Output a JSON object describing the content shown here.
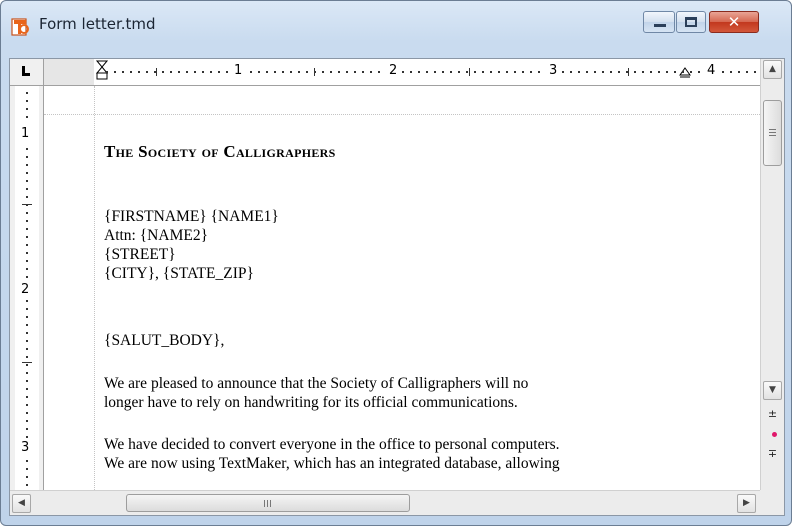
{
  "window": {
    "title": "Form letter.tmd",
    "close_glyph": "✕",
    "app_icon": "textmaker-app-icon"
  },
  "ruler": {
    "horizontal_numbers": [
      "1",
      "2",
      "3",
      "4"
    ],
    "vertical_numbers": [
      "1",
      "2",
      "3"
    ]
  },
  "document": {
    "heading": "The Society of Calligraphers",
    "address_lines": [
      "{FIRSTNAME} {NAME1}",
      "Attn: {NAME2}",
      "{STREET}",
      "{CITY}, {STATE_ZIP}"
    ],
    "salutation": "{SALUT_BODY},",
    "paragraph1": [
      "We are pleased to announce that the Society of Calligraphers will no",
      "longer have to rely on handwriting for its official communications."
    ],
    "paragraph2": [
      "We have decided to convert everyone in the office to personal computers.",
      "We are now using TextMaker, which has an integrated database, allowing"
    ]
  },
  "scrollbars": {
    "up_glyph": "▲",
    "down_glyph": "▼",
    "left_glyph": "◀",
    "right_glyph": "▶",
    "prev_page_glyph": "±",
    "next_page_glyph": "∓",
    "browse_object": "browse-object-dot"
  },
  "colors": {
    "close_button": "#c2381e",
    "browse_dot": "#e0186b",
    "app_icon": "#e8641a"
  }
}
